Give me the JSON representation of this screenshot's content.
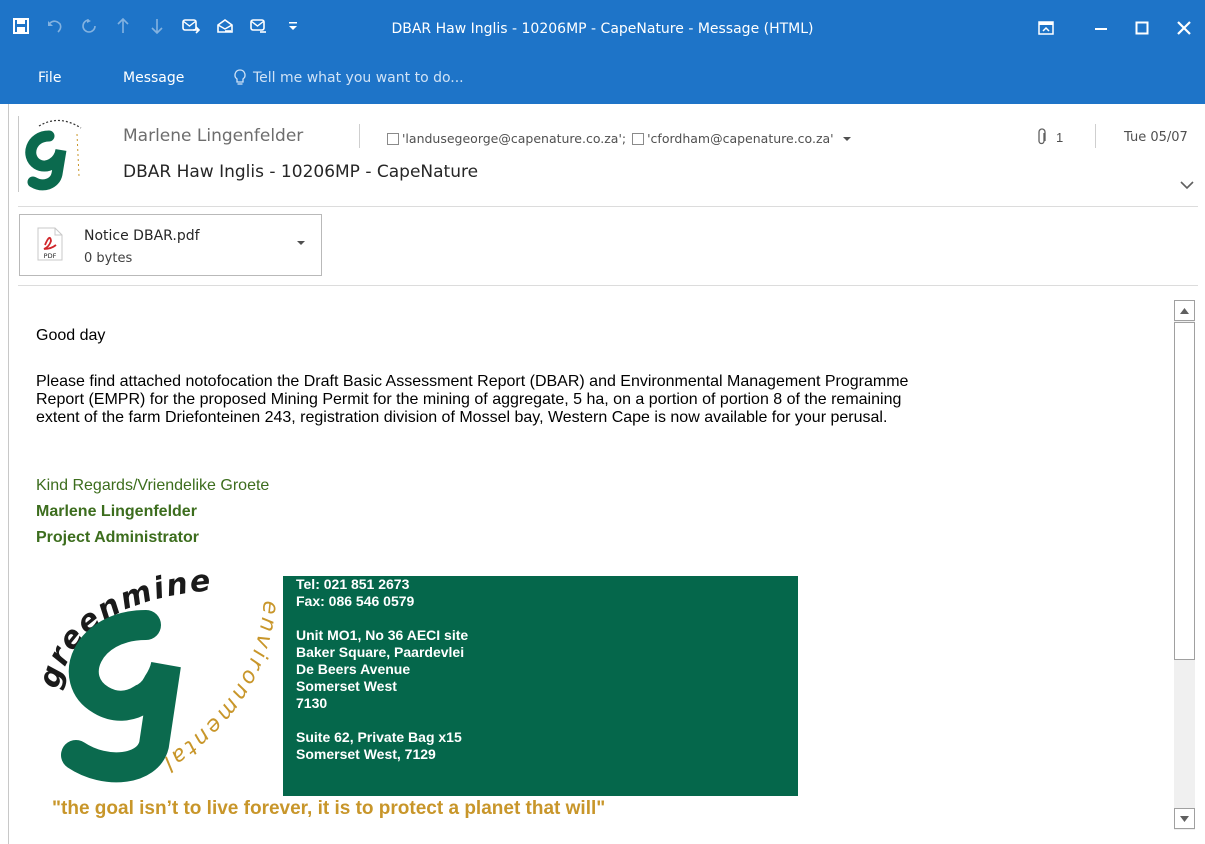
{
  "window": {
    "title": "DBAR Haw Inglis - 10206MP - CapeNature - Message (HTML)",
    "accent": "#1e74c8"
  },
  "qat": {
    "icons": [
      "save-icon",
      "undo-icon",
      "redo-icon",
      "previous-item-icon",
      "next-item-icon",
      "reply-icon",
      "reply-all-icon",
      "forward-icon",
      "customize-toolbar-icon"
    ]
  },
  "ribbon": {
    "tabs": [
      "File",
      "Message"
    ],
    "tell_me": "Tell me what you want to do..."
  },
  "header": {
    "sender": "Marlene Lingenfelder",
    "recipients": [
      "'landusegeorge@capenature.co.za';",
      "'cfordham@capenature.co.za'"
    ],
    "attachment_count": "1",
    "date": "Tue 05/07",
    "subject": "DBAR Haw Inglis - 10206MP - CapeNature"
  },
  "attachment": {
    "name": "Notice DBAR.pdf",
    "size": "0 bytes",
    "type_label": "PDF"
  },
  "body": {
    "greeting": "Good day",
    "paragraph_lines": [
      "Please find attached notofocation the Draft Basic Assessment Report (DBAR) and Environmental Management Programme",
      "Report (EMPR) for the proposed Mining Permit for the mining of aggregate, 5 ha, on a portion of portion 8 of the remaining",
      "extent of the farm Driefonteinen 243, registration division of Mossel bay, Western Cape is now available for your perusal."
    ],
    "signoff": "Kind Regards/Vriendelike Groete",
    "name": "Marlene Lingenfelder",
    "role": "Project Administrator"
  },
  "signature": {
    "logo_top": "greenmined",
    "logo_bottom": "environmental",
    "contact": {
      "tel": "Tel: 021 851 2673",
      "fax": "Fax: 086 546 0579",
      "address1": "Unit MO1, No 36 AECI site",
      "address2": "Baker Square, Paardevlei",
      "address3": "De Beers Avenue",
      "address4": "Somerset West",
      "address5": "7130",
      "postal1": "Suite 62, Private Bag x15",
      "postal2": "Somerset West, 7129"
    },
    "quote": "\"the goal isn’t to live forever, it is to protect a planet that will\"",
    "box_color": "#05674b",
    "quote_color": "#c8962a"
  }
}
